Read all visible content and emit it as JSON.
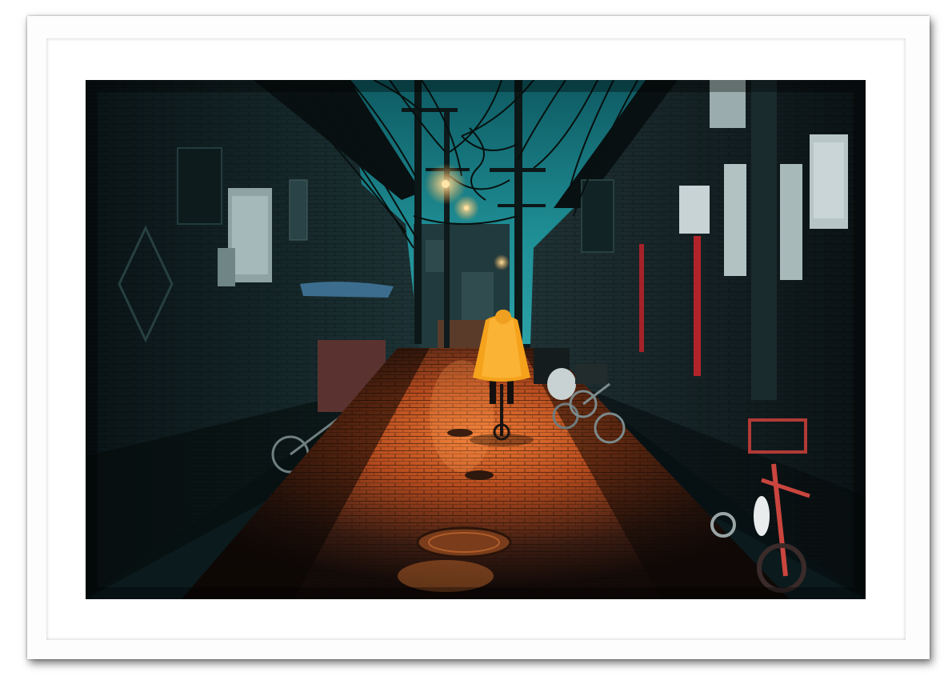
{
  "artwork": {
    "subject": "alley-at-dusk",
    "palette": {
      "sky": "#1f8f96",
      "sky_dark": "#0d4a52",
      "wall_dark": "#0d1a1c",
      "wall_mid": "#1c3134",
      "pavement_glow": "#e06a2a",
      "pavement_dark": "#2a1812",
      "raincoat": "#f5a21c",
      "lamp": "#ffd080",
      "frame": "#fdfdfd",
      "mat": "#ffffff"
    }
  }
}
